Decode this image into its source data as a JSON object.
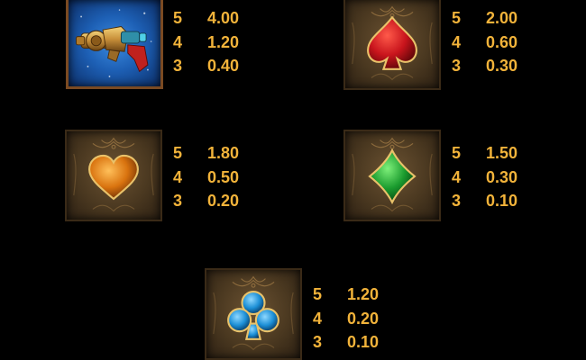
{
  "symbols": [
    {
      "name": "Ray Gun",
      "icon": "ray-gun-icon",
      "pays": [
        {
          "count": "5",
          "value": "4.00"
        },
        {
          "count": "4",
          "value": "1.20"
        },
        {
          "count": "3",
          "value": "0.40"
        }
      ]
    },
    {
      "name": "Spade",
      "icon": "spade-icon",
      "color": "#c8141c",
      "pays": [
        {
          "count": "5",
          "value": "2.00"
        },
        {
          "count": "4",
          "value": "0.60"
        },
        {
          "count": "3",
          "value": "0.30"
        }
      ]
    },
    {
      "name": "Heart",
      "icon": "heart-icon",
      "color": "#d9730f",
      "pays": [
        {
          "count": "5",
          "value": "1.80"
        },
        {
          "count": "4",
          "value": "0.50"
        },
        {
          "count": "3",
          "value": "0.20"
        }
      ]
    },
    {
      "name": "Diamond",
      "icon": "diamond-icon",
      "color": "#1a9b2e",
      "pays": [
        {
          "count": "5",
          "value": "1.50"
        },
        {
          "count": "4",
          "value": "0.30"
        },
        {
          "count": "3",
          "value": "0.10"
        }
      ]
    },
    {
      "name": "Club",
      "icon": "club-icon",
      "color": "#1c8fd6",
      "pays": [
        {
          "count": "5",
          "value": "1.20"
        },
        {
          "count": "4",
          "value": "0.20"
        },
        {
          "count": "3",
          "value": "0.10"
        }
      ]
    }
  ],
  "colors": {
    "payout_text": "#f2b33a",
    "background": "#000000",
    "tile_bronze": "#4a3820"
  }
}
